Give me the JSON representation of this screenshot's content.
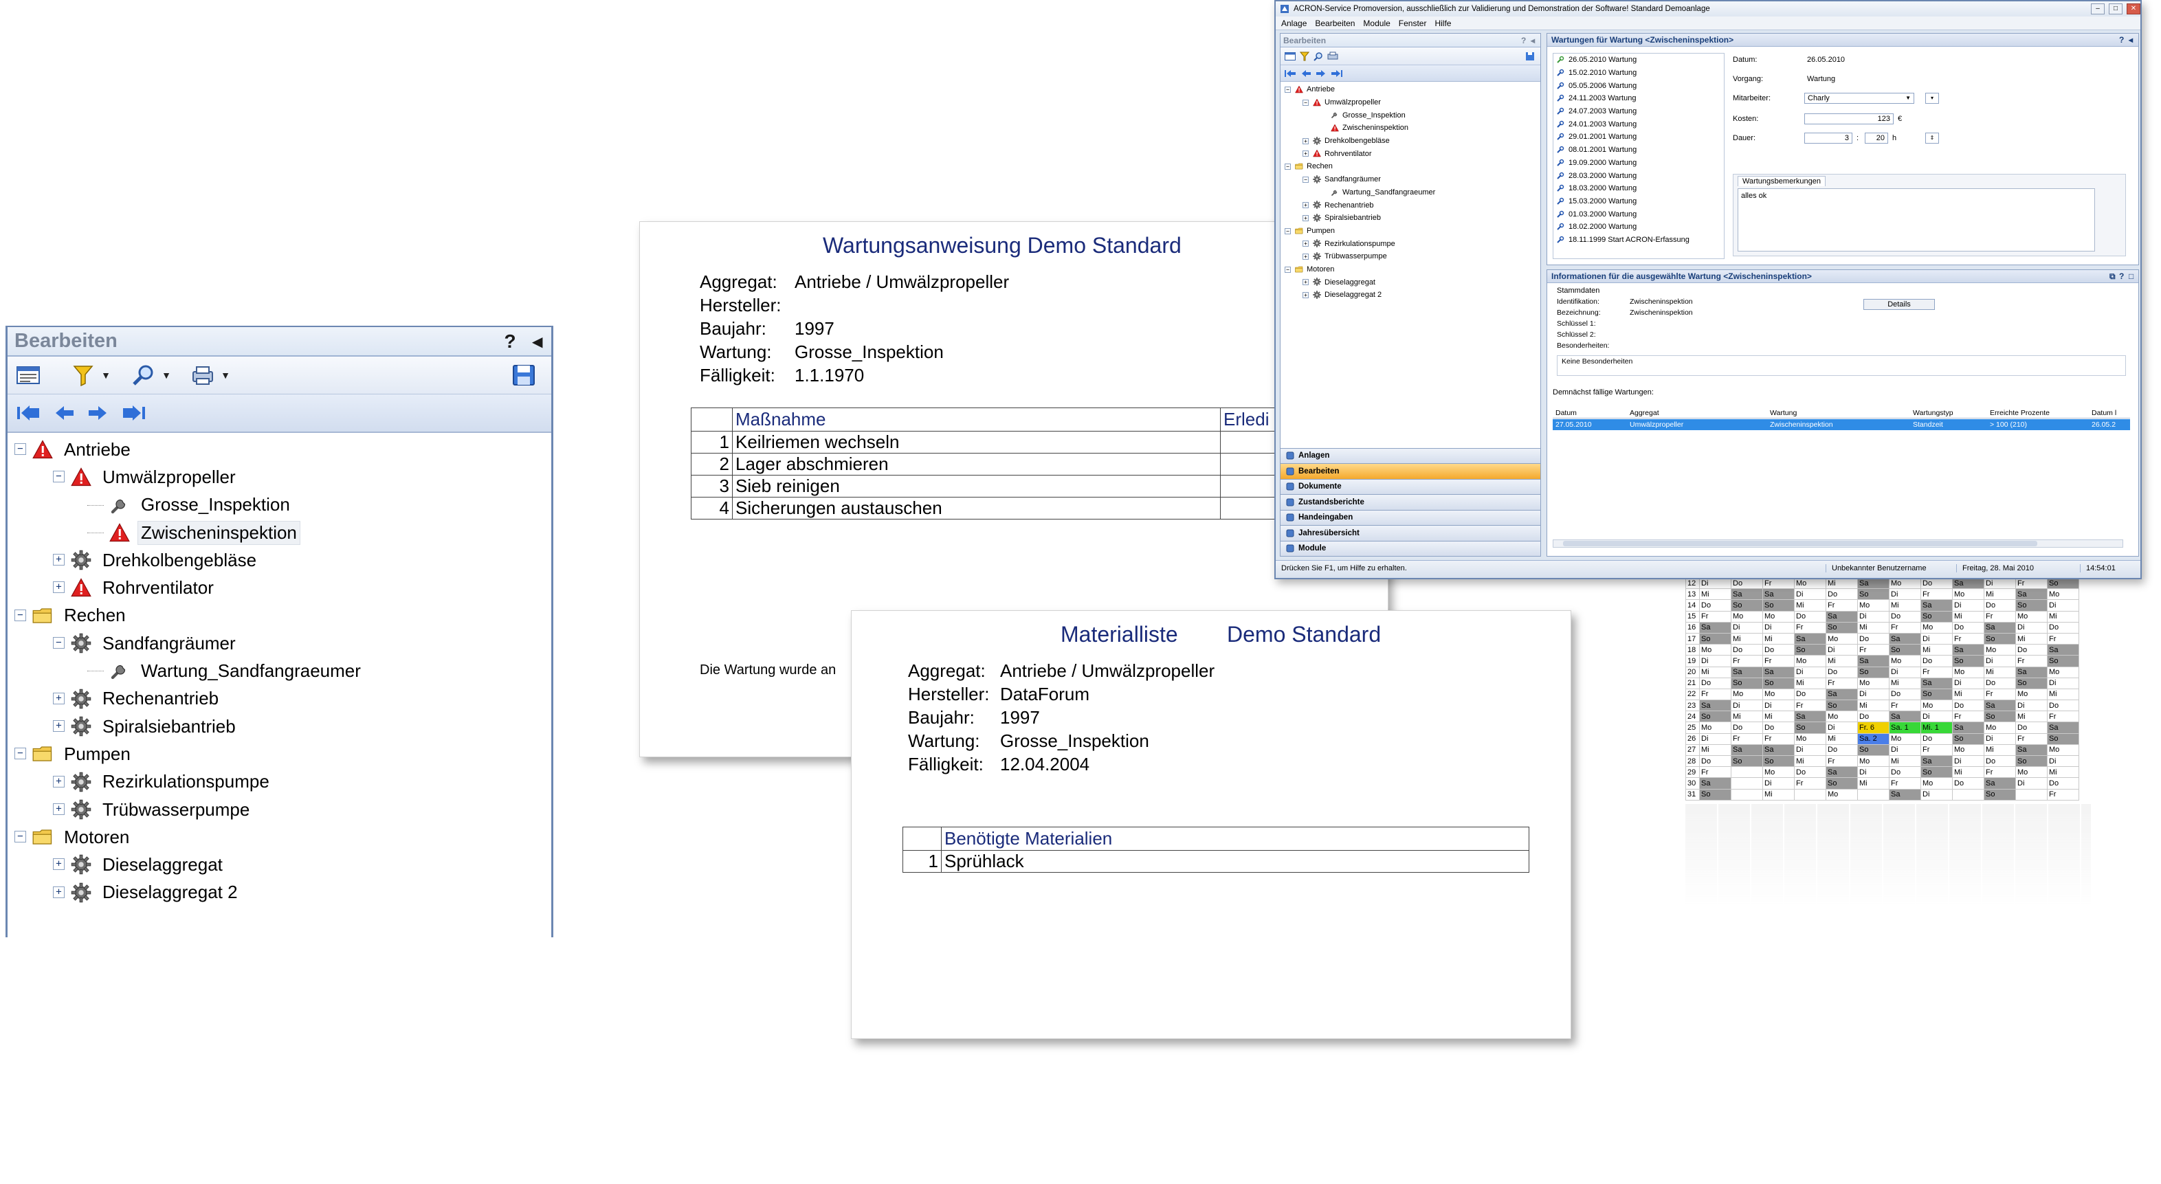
{
  "left_panel": {
    "title": "Bearbeiten",
    "help": "?",
    "collapse": "◂",
    "tree": [
      {
        "label": "Antriebe",
        "level": 0,
        "icon": "warning-icon",
        "expander": "−"
      },
      {
        "label": "Umwälzpropeller",
        "level": 1,
        "icon": "warning-icon",
        "expander": "−"
      },
      {
        "label": "Grosse_Inspektion",
        "level": 2,
        "icon": "wrench-icon",
        "expander": ""
      },
      {
        "label": "Zwischeninspektion",
        "level": 2,
        "icon": "warning-icon",
        "expander": "",
        "selected": true
      },
      {
        "label": "Drehkolbengebläse",
        "level": 1,
        "icon": "gear-icon",
        "expander": "+"
      },
      {
        "label": "Rohrventilator",
        "level": 1,
        "icon": "warning-icon",
        "expander": "+"
      },
      {
        "label": "Rechen",
        "level": 0,
        "icon": "folder-icon",
        "expander": "−"
      },
      {
        "label": "Sandfangräumer",
        "level": 1,
        "icon": "gear-icon",
        "expander": "−"
      },
      {
        "label": "Wartung_Sandfangraeumer",
        "level": 2,
        "icon": "wrench-icon",
        "expander": ""
      },
      {
        "label": "Rechenantrieb",
        "level": 1,
        "icon": "gear-icon",
        "expander": "+"
      },
      {
        "label": "Spiralsiebantrieb",
        "level": 1,
        "icon": "gear-icon",
        "expander": "+"
      },
      {
        "label": "Pumpen",
        "level": 0,
        "icon": "folder-icon",
        "expander": "−"
      },
      {
        "label": "Rezirkulationspumpe",
        "level": 1,
        "icon": "gear-icon",
        "expander": "+"
      },
      {
        "label": "Trübwasserpumpe",
        "level": 1,
        "icon": "gear-icon",
        "expander": "+"
      },
      {
        "label": "Motoren",
        "level": 0,
        "icon": "folder-icon",
        "expander": "−"
      },
      {
        "label": "Dieselaggregat",
        "level": 1,
        "icon": "gear-icon",
        "expander": "+"
      },
      {
        "label": "Dieselaggregat  2",
        "level": 1,
        "icon": "gear-icon",
        "expander": "+"
      }
    ]
  },
  "doc_wartung": {
    "title": "Wartungsanweisung Demo Standard",
    "fields": [
      {
        "key": "Aggregat:",
        "value": "Antriebe / Umwälzpropeller"
      },
      {
        "key": "Hersteller:",
        "value": ""
      },
      {
        "key": "Baujahr:",
        "value": "1997"
      },
      {
        "key": "Wartung:",
        "value": "Grosse_Inspektion"
      },
      {
        "key": "Fälligkeit:",
        "value": "1.1.1970"
      }
    ],
    "col_header": "Maßnahme",
    "col_header2": "Erledi",
    "rows": [
      {
        "n": "1",
        "text": "Keilriemen wechseln"
      },
      {
        "n": "2",
        "text": "Lager abschmieren"
      },
      {
        "n": "3",
        "text": "Sieb reinigen"
      },
      {
        "n": "4",
        "text": "Sicherungen austauschen"
      }
    ],
    "footer": "Die Wartung wurde an"
  },
  "doc_material": {
    "title": "Materialliste",
    "title2": "Demo Standard",
    "fields": [
      {
        "key": "Aggregat:",
        "value": "Antriebe / Umwälzpropeller"
      },
      {
        "key": "Hersteller:",
        "value": "DataForum"
      },
      {
        "key": "Baujahr:",
        "value": "1997"
      },
      {
        "key": "Wartung:",
        "value": "Grosse_Inspektion"
      },
      {
        "key": "Fälligkeit:",
        "value": "12.04.2004"
      }
    ],
    "col_header": "Benötigte Materialien",
    "rows": [
      {
        "n": "1",
        "text": "Sprühlack"
      }
    ]
  },
  "calendar": {
    "rows": [
      [
        "12",
        "Di",
        "Do",
        "Fr",
        "Mo",
        "Mi",
        "Sa",
        "Mo",
        "Do",
        "Sa",
        "Di",
        "Fr",
        "So"
      ],
      [
        "13",
        "Mi",
        "Sa",
        "Sa",
        "Di",
        "Do",
        "So",
        "Di",
        "Fr",
        "Mo",
        "Mi",
        "Sa",
        "Mo"
      ],
      [
        "14",
        "Do",
        "So",
        "So",
        "Mi",
        "Fr",
        "Mo",
        "Mi",
        "Sa",
        "Di",
        "Do",
        "So",
        "Di"
      ],
      [
        "15",
        "Fr",
        "Mo",
        "Mo",
        "Do",
        "Sa",
        "Di",
        "Do",
        "So",
        "Mi",
        "Fr",
        "Mo",
        "Mi"
      ],
      [
        "16",
        "Sa",
        "Di",
        "Di",
        "Fr",
        "So",
        "Mi",
        "Fr",
        "Mo",
        "Do",
        "Sa",
        "Di",
        "Do"
      ],
      [
        "17",
        "So",
        "Mi",
        "Mi",
        "Sa",
        "Mo",
        "Do",
        "Sa",
        "Di",
        "Fr",
        "So",
        "Mi",
        "Fr"
      ],
      [
        "18",
        "Mo",
        "Do",
        "Do",
        "So",
        "Di",
        "Fr",
        "So",
        "Mi",
        "Sa",
        "Mo",
        "Do",
        "Sa"
      ],
      [
        "19",
        "Di",
        "Fr",
        "Fr",
        "Mo",
        "Mi",
        "Sa",
        "Mo",
        "Do",
        "So",
        "Di",
        "Fr",
        "So"
      ],
      [
        "20",
        "Mi",
        "Sa",
        "Sa",
        "Di",
        "Do",
        "So",
        "Di",
        "Fr",
        "Mo",
        "Mi",
        "Sa",
        "Mo"
      ],
      [
        "21",
        "Do",
        "So",
        "So",
        "Mi",
        "Fr",
        "Mo",
        "Mi",
        "Sa",
        "Di",
        "Do",
        "So",
        "Di"
      ],
      [
        "22",
        "Fr",
        "Mo",
        "Mo",
        "Do",
        "Sa",
        "Di",
        "Do",
        "So",
        "Mi",
        "Fr",
        "Mo",
        "Mi"
      ],
      [
        "23",
        "Sa",
        "Di",
        "Di",
        "Fr",
        "So",
        "Mi",
        "Fr",
        "Mo",
        "Do",
        "Sa",
        "Di",
        "Do"
      ],
      [
        "24",
        "So",
        "Mi",
        "Mi",
        "Sa",
        "Mo",
        "Do",
        "Sa",
        "Di",
        "Fr",
        "So",
        "Mi",
        "Fr"
      ],
      [
        "25",
        "Mo",
        "Do",
        "Do",
        "So",
        "Di",
        "Fr. 6",
        "Sa. 1",
        "Mi. 1",
        "Sa",
        "Mo",
        "Do",
        "Sa"
      ],
      [
        "26",
        "Di",
        "Fr",
        "Fr",
        "Mo",
        "Mi",
        "Sa. 2",
        "Mo",
        "Do",
        "So",
        "Di",
        "Fr",
        "So"
      ],
      [
        "27",
        "Mi",
        "Sa",
        "Sa",
        "Di",
        "Do",
        "So",
        "Di",
        "Fr",
        "Mo",
        "Mi",
        "Sa",
        "Mo"
      ],
      [
        "28",
        "Do",
        "So",
        "So",
        "Mi",
        "Fr",
        "Mo",
        "Mi",
        "Sa",
        "Di",
        "Do",
        "So",
        "Di"
      ],
      [
        "29",
        "Fr",
        "",
        "Mo",
        "Do",
        "Sa",
        "Di",
        "Do",
        "So",
        "Mi",
        "Fr",
        "Mo",
        "Mi"
      ],
      [
        "30",
        "Sa",
        "",
        "Di",
        "Fr",
        "So",
        "Mi",
        "Fr",
        "Mo",
        "Do",
        "Sa",
        "Di",
        "Do"
      ],
      [
        "31",
        "So",
        "",
        "Mi",
        "",
        "Mo",
        "",
        "Sa",
        "Di",
        "",
        "So",
        "",
        "Fr"
      ]
    ]
  },
  "app": {
    "title": "ACRON-Service Promoversion, ausschließlich zur Validierung und Demonstration der Software! Standard Demoanlage",
    "menu": [
      "Anlage",
      "Bearbeiten",
      "Module",
      "Fenster",
      "Hilfe"
    ],
    "left_title": "Bearbeiten",
    "tree": [
      {
        "label": "Antriebe",
        "level": 0,
        "icon": "warning-icon",
        "expander": "−"
      },
      {
        "label": "Umwälzpropeller",
        "level": 1,
        "icon": "warning-icon",
        "expander": "−"
      },
      {
        "label": "Grosse_Inspektion",
        "level": 2,
        "icon": "wrench-icon",
        "expander": ""
      },
      {
        "label": "Zwischeninspektion",
        "level": 2,
        "icon": "warning-icon",
        "expander": ""
      },
      {
        "label": "Drehkolbengebläse",
        "level": 1,
        "icon": "gear-icon",
        "expander": "+"
      },
      {
        "label": "Rohrventilator",
        "level": 1,
        "icon": "warning-icon",
        "expander": "+"
      },
      {
        "label": "Rechen",
        "level": 0,
        "icon": "folder-icon",
        "expander": "−"
      },
      {
        "label": "Sandfangräumer",
        "level": 1,
        "icon": "gear-icon",
        "expander": "−"
      },
      {
        "label": "Wartung_Sandfangraeumer",
        "level": 2,
        "icon": "wrench-icon",
        "expander": ""
      },
      {
        "label": "Rechenantrieb",
        "level": 1,
        "icon": "gear-icon",
        "expander": "+"
      },
      {
        "label": "Spiralsiebantrieb",
        "level": 1,
        "icon": "gear-icon",
        "expander": "+"
      },
      {
        "label": "Pumpen",
        "level": 0,
        "icon": "folder-icon",
        "expander": "−"
      },
      {
        "label": "Rezirkulationspumpe",
        "level": 1,
        "icon": "gear-icon",
        "expander": "+"
      },
      {
        "label": "Trübwasserpumpe",
        "level": 1,
        "icon": "gear-icon",
        "expander": "+"
      },
      {
        "label": "Motoren",
        "level": 0,
        "icon": "folder-icon",
        "expander": "−"
      },
      {
        "label": "Dieselaggregat",
        "level": 1,
        "icon": "gear-icon",
        "expander": "+"
      },
      {
        "label": "Dieselaggregat  2",
        "level": 1,
        "icon": "gear-icon",
        "expander": "+"
      }
    ],
    "nav": [
      "Anlagen",
      "Bearbeiten",
      "Dokumente",
      "Zustandsberichte",
      "Handeingaben",
      "Jahresübersicht",
      "Module"
    ],
    "nav_active": "Bearbeiten",
    "sec1_title": "Wartungen für Wartung <Zwischeninspektion>",
    "maint_list": [
      "26.05.2010  Wartung",
      "15.02.2010  Wartung",
      "05.05.2006  Wartung",
      "24.11.2003  Wartung",
      "24.07.2003  Wartung",
      "24.01.2003  Wartung",
      "29.01.2001  Wartung",
      "08.01.2001  Wartung",
      "19.09.2000  Wartung",
      "28.03.2000  Wartung",
      "18.03.2000  Wartung",
      "15.03.2000  Wartung",
      "01.03.2000  Wartung",
      "18.02.2000  Wartung",
      "18.11.1999  Start ACRON-Erfassung"
    ],
    "form": {
      "datum_label": "Datum:",
      "datum": "26.05.2010",
      "vorgang_label": "Vorgang:",
      "vorgang": "Wartung",
      "mitarbeiter_label": "Mitarbeiter:",
      "mitarbeiter": "Charly",
      "kosten_label": "Kosten:",
      "kosten": "123",
      "currency": "€",
      "dauer_label": "Dauer:",
      "dauer_h": "3",
      "dauer_sep": ":",
      "dauer_m": "20",
      "dauer_unit": "h",
      "notes_tab": "Wartungsbemerkungen",
      "notes": "alles ok"
    },
    "sec2_title": "Informationen für die ausgewählte Wartung <Zwischeninspektion>",
    "stammdaten": "Stammdaten",
    "info": [
      {
        "k": "Identifikation:",
        "v": "Zwischeninspektion"
      },
      {
        "k": "Bezeichnung:",
        "v": "Zwischeninspektion"
      },
      {
        "k": "Schlüssel 1:",
        "v": ""
      },
      {
        "k": "Schlüssel 2:",
        "v": ""
      },
      {
        "k": "Besonderheiten:",
        "v": ""
      }
    ],
    "details_button": "Details",
    "besonderheiten": "Keine Besonderheiten",
    "due_title": "Demnächst fällige Wartungen:",
    "due_headers": [
      "Datum",
      "Aggregat",
      "Wartung",
      "Wartungstyp",
      "Erreichte Prozente",
      "Datum l"
    ],
    "due_row": [
      "27.05.2010",
      "Umwälzpropeller",
      "Zwischeninspektion",
      "Standzeit",
      "> 100 (210)",
      "26.05.2"
    ],
    "status": {
      "hint": "Drücken Sie F1, um Hilfe zu erhalten.",
      "user": "Unbekannter Benutzername",
      "date": "Freitag, 28. Mai 2010",
      "time": "14:54:01"
    }
  },
  "colors": {
    "accent_blue": "#1a2b7a",
    "warning_red": "#e02020",
    "selection_blue": "#2f8ce6",
    "active_nav": "#f4a92c"
  }
}
